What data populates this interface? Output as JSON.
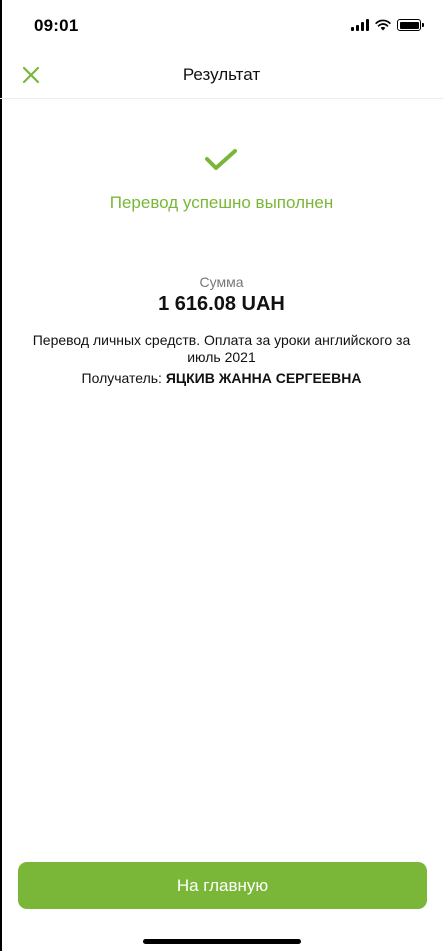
{
  "status_bar": {
    "time": "09:01",
    "icons": [
      "signal-icon",
      "wifi-icon",
      "battery-icon"
    ]
  },
  "nav": {
    "title": "Результат",
    "close_icon": "close-icon"
  },
  "result": {
    "success_icon": "checkmark-icon",
    "message": "Перевод успешно выполнен",
    "amount_label": "Сумма",
    "amount_value": "1 616.08 UAH",
    "description": "Перевод личных средств. Оплата за уроки английского за июль 2021",
    "recipient_label": "Получатель:",
    "recipient_name": "ЯЦКИВ ЖАННА СЕРГЕЕВНА"
  },
  "actions": {
    "home_label": "На главную"
  },
  "colors": {
    "accent": "#7ab738",
    "muted_text": "#777777",
    "text": "#111111"
  }
}
